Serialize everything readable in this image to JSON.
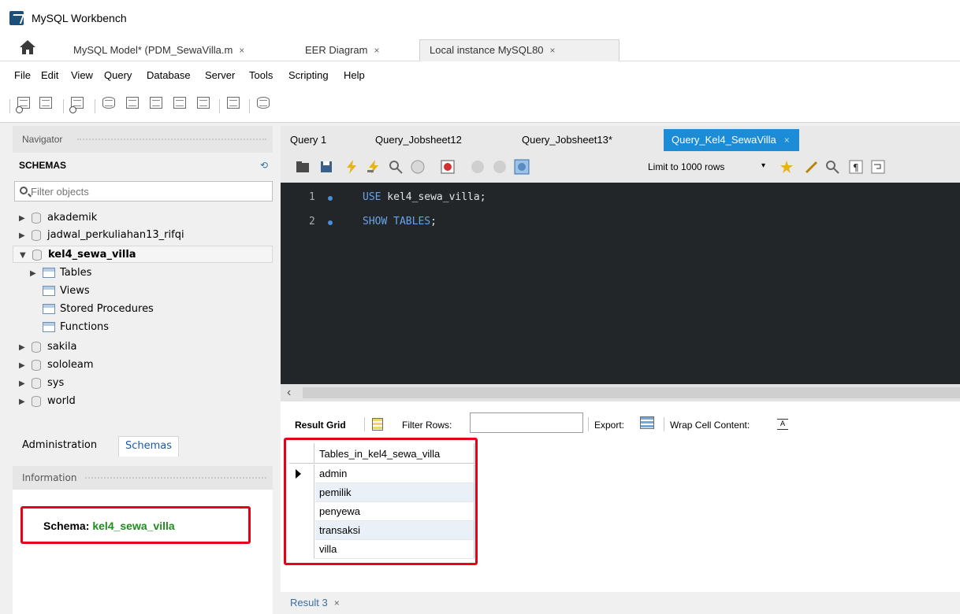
{
  "window": {
    "title": "MySQL Workbench"
  },
  "doc_tabs": [
    {
      "label": "MySQL Model* (PDM_SewaVilla.m",
      "close": "×"
    },
    {
      "label": "EER Diagram",
      "close": "×"
    },
    {
      "label": "Local instance MySQL80",
      "close": "×"
    }
  ],
  "menu": [
    "File",
    "Edit",
    "View",
    "Query",
    "Database",
    "Server",
    "Tools",
    "Scripting",
    "Help"
  ],
  "navigator": {
    "header": "Navigator",
    "schemas_title": "SCHEMAS",
    "filter_placeholder": "Filter objects",
    "tree": [
      {
        "label": "akademik",
        "type": "db",
        "expanded": false
      },
      {
        "label": "jadwal_perkuliahan13_rifqi",
        "type": "db",
        "expanded": false
      },
      {
        "label": "kel4_sewa_villa",
        "type": "db",
        "expanded": true
      },
      {
        "label": "Tables",
        "type": "folder"
      },
      {
        "label": "Views",
        "type": "folder"
      },
      {
        "label": "Stored Procedures",
        "type": "folder"
      },
      {
        "label": "Functions",
        "type": "folder"
      },
      {
        "label": "sakila",
        "type": "db",
        "expanded": false
      },
      {
        "label": "sololeam",
        "type": "db",
        "expanded": false
      },
      {
        "label": "sys",
        "type": "db",
        "expanded": false
      },
      {
        "label": "world",
        "type": "db",
        "expanded": false
      }
    ]
  },
  "left_tabs": {
    "administration": "Administration",
    "schemas": "Schemas"
  },
  "information": {
    "header": "Information",
    "schema_label": "Schema:",
    "schema_value": "kel4_sewa_villa"
  },
  "query_tabs": [
    {
      "label": "Query 1"
    },
    {
      "label": "Query_Jobsheet12"
    },
    {
      "label": "Query_Jobsheet13*"
    },
    {
      "label": "Query_Kel4_SewaVilla",
      "close": "×",
      "active": true
    }
  ],
  "query_toolbar": {
    "limit_label": "Limit to 1000 rows",
    "limit_arrow": "▾"
  },
  "editor": {
    "lines": [
      {
        "num": "1",
        "kw": "USE",
        "rest": " kel4_sewa_villa;"
      },
      {
        "num": "2",
        "kw": "SHOW TABLES",
        "rest": ";"
      }
    ]
  },
  "hscroll": {
    "left_arrow": "‹"
  },
  "result_toolbar": {
    "result_grid": "Result Grid",
    "filter_rows": "Filter Rows:",
    "filter_value": "",
    "export": "Export:",
    "wrap": "Wrap Cell Content:"
  },
  "result": {
    "column": "Tables_in_kel4_sewa_villa",
    "rows": [
      "admin",
      "pemilik",
      "penyewa",
      "transaksi",
      "villa"
    ]
  },
  "result_tabs": [
    {
      "label": "Result 3",
      "close": "×"
    }
  ],
  "colors": {
    "accent": "#1d8cd6",
    "highlight_border": "#e6001a",
    "schema_value": "#1f8c1f",
    "editor_bg": "#232629"
  }
}
